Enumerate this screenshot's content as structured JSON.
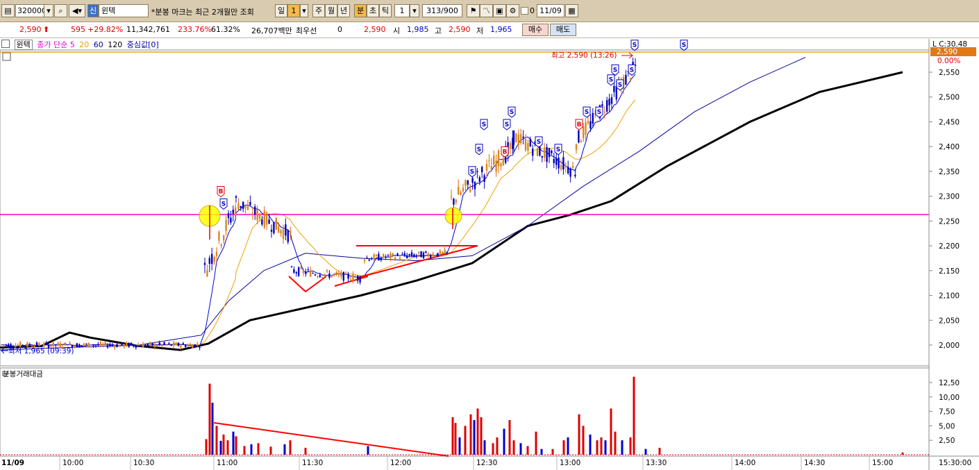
{
  "toolbar": {
    "code": "320000",
    "badge": "신",
    "stock_name": "윈텍",
    "notice": "*분봉 마크는 최근 2개월만 조회",
    "period_tabs": [
      "일",
      "1",
      "주",
      "월",
      "년",
      "분",
      "초",
      "틱"
    ],
    "interval": "1",
    "count": "313/900",
    "checkbox_label": "0",
    "date": "11/09"
  },
  "quote": {
    "price": "2,590",
    "change": "595",
    "change_pct": "+29.82%",
    "volume": "11,342,761",
    "vol_ratio": "233.76%",
    "turnover": "61.32%",
    "amount": "26,707백만",
    "pref_label": "최우선",
    "pref_value": "0",
    "pref_price": "2,590",
    "open_label": "시",
    "open": "1,985",
    "high_label": "고",
    "high": "2,590",
    "low_label": "저",
    "low": "1,965",
    "buy_label": "매수",
    "sell_label": "매도"
  },
  "legend": {
    "name": "윈텍",
    "ma_title": "종가 단순 5",
    "ma20": "20",
    "ma60": "60",
    "ma120": "120",
    "center": "중심값[0]"
  },
  "colors": {
    "up": "#e00000",
    "down": "#0000d0",
    "ma5": "#e000e0",
    "ma20": "#f0a000",
    "ma60": "#0000a0",
    "ma120": "#000000",
    "line_high": "#f0a000",
    "line_magenta": "#ff00c0",
    "trend": "#ff0000"
  },
  "chart_data": {
    "type": "candlestick",
    "price_axis_ticks": [
      "2,550",
      "2,500",
      "2,450",
      "2,400",
      "2,350",
      "2,300",
      "2,250",
      "2,200",
      "2,150",
      "2,100",
      "2,050",
      "2,000"
    ],
    "price_top_label": "L C:30.48",
    "price_tag": "2,590",
    "price_tag_pct": "0.00%",
    "ylim": [
      1990,
      2590
    ],
    "high_annot": "최고 2,590 (13:26)",
    "low_annot": "최저 1,965 (09:39)",
    "volume_title": "분봉거래대금",
    "volume_axis_ticks": [
      "12,50",
      "10,00",
      "7,50",
      "5,00",
      "2,50"
    ],
    "time_labels": [
      "11/09",
      "10:00",
      "10:30",
      "11:00",
      "11:30",
      "12:00",
      "12:30",
      "13:00",
      "13:30",
      "14:00",
      "14:30",
      "15:00",
      "15:30:00"
    ],
    "ma120_points": [
      [
        0,
        1995
      ],
      [
        60,
        1998
      ],
      [
        100,
        2025
      ],
      [
        130,
        2015
      ],
      [
        200,
        1998
      ],
      [
        260,
        1990
      ],
      [
        300,
        2003
      ],
      [
        360,
        2050
      ],
      [
        440,
        2075
      ],
      [
        520,
        2100
      ],
      [
        600,
        2130
      ],
      [
        680,
        2165
      ],
      [
        760,
        2240
      ],
      [
        820,
        2262
      ],
      [
        880,
        2290
      ],
      [
        960,
        2360
      ],
      [
        1080,
        2450
      ],
      [
        1180,
        2510
      ],
      [
        1300,
        2550
      ]
    ],
    "ma60_points": [
      [
        0,
        1990
      ],
      [
        200,
        2000
      ],
      [
        290,
        2020
      ],
      [
        330,
        2090
      ],
      [
        380,
        2150
      ],
      [
        440,
        2185
      ],
      [
        520,
        2175
      ],
      [
        600,
        2170
      ],
      [
        680,
        2180
      ],
      [
        760,
        2240
      ],
      [
        840,
        2320
      ],
      [
        920,
        2390
      ],
      [
        1000,
        2470
      ],
      [
        1080,
        2530
      ],
      [
        1160,
        2580
      ]
    ],
    "candle_segments": [
      {
        "from": [
          2,
          2000
        ],
        "to": [
          290,
          2000
        ],
        "noise": 12
      },
      {
        "from": [
          295,
          2150
        ],
        "to": [
          340,
          2280
        ],
        "noise": 45
      },
      {
        "from": [
          340,
          2290
        ],
        "to": [
          420,
          2220
        ],
        "noise": 35
      },
      {
        "from": [
          420,
          2150
        ],
        "to": [
          520,
          2135
        ],
        "noise": 18
      },
      {
        "from": [
          525,
          2175
        ],
        "to": [
          645,
          2185
        ],
        "noise": 15
      },
      {
        "from": [
          650,
          2290
        ],
        "to": [
          740,
          2400
        ],
        "noise": 40
      },
      {
        "from": [
          740,
          2420
        ],
        "to": [
          830,
          2350
        ],
        "noise": 35
      },
      {
        "from": [
          830,
          2410
        ],
        "to": [
          915,
          2560
        ],
        "noise": 35
      }
    ],
    "volume_bars": [
      [
        302,
        12.3
      ],
      [
        306,
        9
      ],
      [
        297,
        2.7
      ],
      [
        312,
        5
      ],
      [
        318,
        2.4
      ],
      [
        322,
        3.5
      ],
      [
        328,
        2.5
      ],
      [
        336,
        4
      ],
      [
        340,
        3.2
      ],
      [
        352,
        1.5
      ],
      [
        362,
        1.8
      ],
      [
        372,
        2
      ],
      [
        390,
        1.4
      ],
      [
        410,
        1.8
      ],
      [
        418,
        2.5
      ],
      [
        440,
        1.2
      ],
      [
        530,
        1.5
      ],
      [
        652,
        6.5
      ],
      [
        656,
        5.5
      ],
      [
        662,
        3
      ],
      [
        670,
        5
      ],
      [
        678,
        7
      ],
      [
        683,
        6
      ],
      [
        688,
        8
      ],
      [
        693,
        6.5
      ],
      [
        698,
        2.5
      ],
      [
        710,
        2
      ],
      [
        716,
        3
      ],
      [
        726,
        4.5
      ],
      [
        734,
        6
      ],
      [
        740,
        2.5
      ],
      [
        750,
        2
      ],
      [
        760,
        1.5
      ],
      [
        772,
        4
      ],
      [
        780,
        1
      ],
      [
        796,
        1
      ],
      [
        812,
        2.5
      ],
      [
        818,
        3
      ],
      [
        834,
        7
      ],
      [
        840,
        5
      ],
      [
        850,
        3.5
      ],
      [
        860,
        2.5
      ],
      [
        866,
        3
      ],
      [
        872,
        2.5
      ],
      [
        880,
        8
      ],
      [
        886,
        4
      ],
      [
        896,
        2.5
      ],
      [
        908,
        3
      ],
      [
        913,
        13.5
      ],
      [
        930,
        1
      ],
      [
        950,
        1.2
      ],
      [
        1300,
        0.4
      ]
    ],
    "signals": {
      "S": [
        [
          322,
          2285
        ],
        [
          680,
          2350
        ],
        [
          690,
          2395
        ],
        [
          697,
          2445
        ],
        [
          730,
          2445
        ],
        [
          737,
          2470
        ],
        [
          776,
          2410
        ],
        [
          804,
          2395
        ],
        [
          845,
          2470
        ],
        [
          863,
          2470
        ],
        [
          880,
          2535
        ],
        [
          886,
          2555
        ],
        [
          893,
          2525
        ],
        [
          910,
          2555
        ],
        [
          914,
          2605
        ],
        [
          985,
          2605
        ]
      ],
      "B": [
        [
          318,
          2310
        ],
        [
          727,
          2390
        ],
        [
          834,
          2445
        ]
      ]
    }
  }
}
